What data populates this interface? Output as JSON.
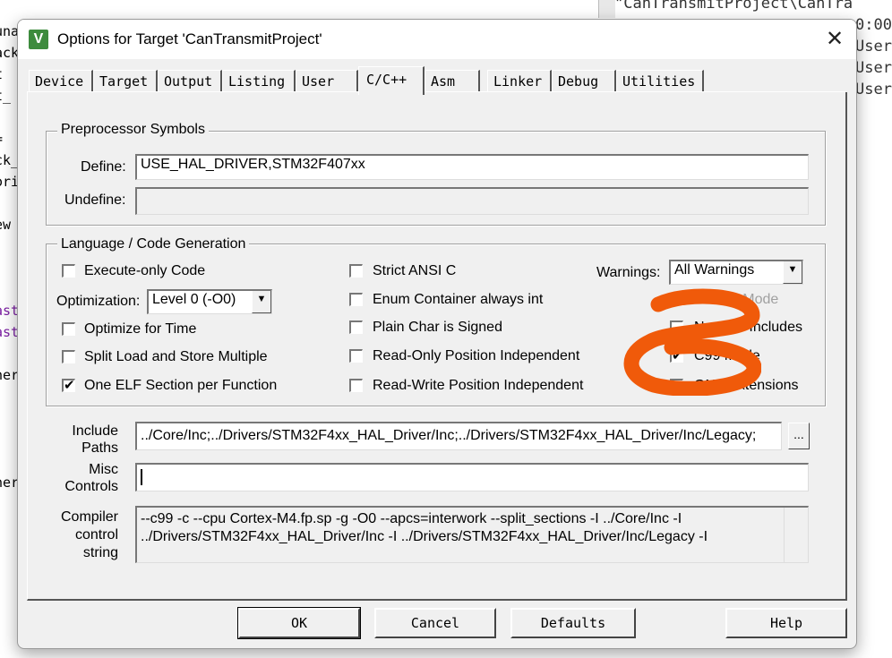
{
  "background": {
    "left_fragments": [
      "una",
      "ack",
      "t",
      "t_",
      "=",
      "ck_",
      "ori",
      "ew",
      "ast",
      "ast",
      "ner",
      "ner"
    ],
    "right_top": "\"CanTransmitProject\\CanTra",
    "right_fragments": [
      "0:00",
      "User",
      "User",
      "User"
    ]
  },
  "dialog": {
    "icon_label": "V",
    "title": "Options for Target 'CanTransmitProject'",
    "close_label": "✕"
  },
  "tabs": [
    "Device",
    "Target",
    "Output",
    "Listing",
    "User",
    "C/C++",
    "Asm",
    "Linker",
    "Debug",
    "Utilities"
  ],
  "active_tab": "C/C++",
  "preprocessor": {
    "group_title": "Preprocessor Symbols",
    "define_label": "Define:",
    "define_value": "USE_HAL_DRIVER,STM32F407xx",
    "undefine_label": "Undefine:",
    "undefine_value": ""
  },
  "language": {
    "group_title": "Language / Code Generation",
    "execute_only": "Execute-only Code",
    "optimization_label": "Optimization:",
    "optimization_value": "Level 0 (-O0)",
    "optimize_time": "Optimize for Time",
    "split_load": "Split Load and Store Multiple",
    "one_elf": "One ELF Section per Function",
    "strict_ansi": "Strict ANSI C",
    "enum_container": "Enum Container always int",
    "plain_char": "Plain Char is Signed",
    "ro_pi": "Read-Only Position Independent",
    "rw_pi": "Read-Write Position Independent",
    "warnings_label": "Warnings:",
    "warnings_value": "All Warnings",
    "thumb_mode": "Thumb Mode",
    "no_auto_includes": "No Auto Includes",
    "c99_mode": "C99 Mode",
    "gnu_extensions": "GNU extensions",
    "check_mark": "✔"
  },
  "include": {
    "label_line1": "Include",
    "label_line2": "Paths",
    "value": "../Core/Inc;../Drivers/STM32F4xx_HAL_Driver/Inc;../Drivers/STM32F4xx_HAL_Driver/Inc/Legacy;",
    "browse_label": "..."
  },
  "misc": {
    "label_line1": "Misc",
    "label_line2": "Controls",
    "value": ""
  },
  "compiler": {
    "label_line1": "Compiler",
    "label_line2": "control",
    "label_line3": "string",
    "value": "--c99 -c --cpu Cortex-M4.fp.sp -g -O0 --apcs=interwork --split_sections -I ../Core/Inc -I ../Drivers/STM32F4xx_HAL_Driver/Inc -I ../Drivers/STM32F4xx_HAL_Driver/Inc/Legacy -I"
  },
  "buttons": {
    "ok": "OK",
    "cancel": "Cancel",
    "defaults": "Defaults",
    "help": "Help"
  },
  "colors": {
    "annotation": "#f05a0a",
    "icon_green": "#3d8b3d"
  }
}
